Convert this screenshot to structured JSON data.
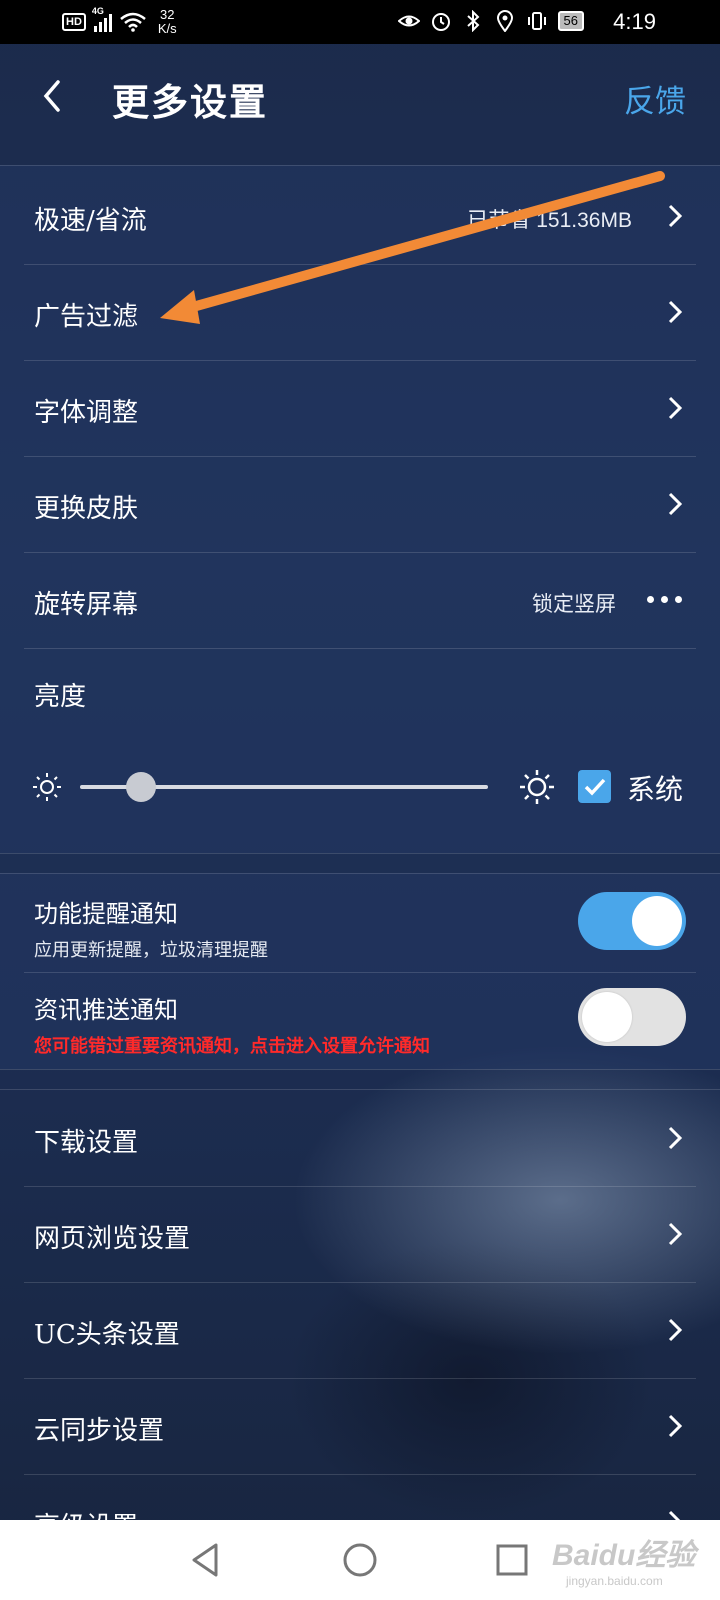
{
  "status_bar": {
    "hd": "HD",
    "network": "4G",
    "speed_value": "32",
    "speed_unit": "K/s",
    "battery": "56",
    "time": "4:19"
  },
  "header": {
    "title": "更多设置",
    "feedback": "反馈"
  },
  "settings_top": [
    {
      "label": "极速/省流",
      "value": "已节省 151.36MB",
      "control": "chevron"
    },
    {
      "label": "广告过滤",
      "value": "",
      "control": "chevron"
    },
    {
      "label": "字体调整",
      "value": "",
      "control": "chevron"
    },
    {
      "label": "更换皮肤",
      "value": "",
      "control": "chevron"
    },
    {
      "label": "旋转屏幕",
      "value": "锁定竖屏",
      "control": "more"
    }
  ],
  "brightness": {
    "label": "亮度",
    "level": 0.15,
    "system_label": "系统",
    "system_checked": true
  },
  "notifications": [
    {
      "title": "功能提醒通知",
      "subtitle": "应用更新提醒，垃圾清理提醒",
      "enabled": true,
      "warning": false
    },
    {
      "title": "资讯推送通知",
      "subtitle": "您可能错过重要资讯通知，点击进入设置允许通知",
      "enabled": false,
      "warning": true
    }
  ],
  "settings_bottom": [
    {
      "label": "下载设置"
    },
    {
      "label": "网页浏览设置"
    },
    {
      "label": "UC头条设置"
    },
    {
      "label": "云同步设置"
    },
    {
      "label": "高级设置"
    }
  ],
  "watermark": {
    "brand": "Baidu经验",
    "site": "jingyan.baidu.com"
  },
  "colors": {
    "accent": "#4aa6ea",
    "warning": "#ff2a2a",
    "annotation_arrow": "#f28a36",
    "background": "#1d2d4f"
  }
}
